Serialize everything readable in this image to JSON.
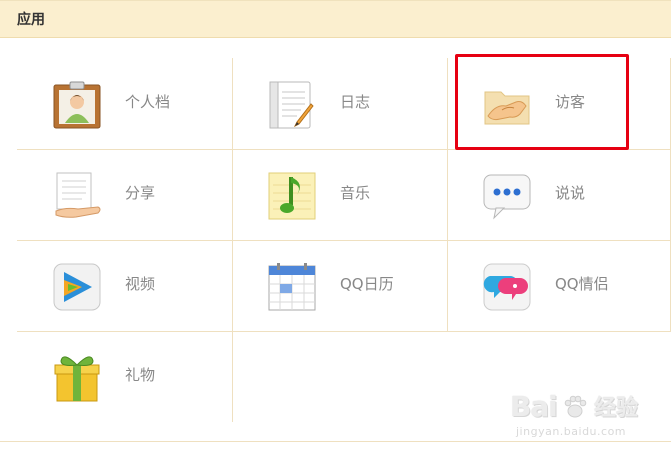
{
  "header": {
    "title": "应用"
  },
  "apps": [
    {
      "label": "个人档",
      "icon": "profile-clipboard-icon"
    },
    {
      "label": "日志",
      "icon": "diary-notebook-icon"
    },
    {
      "label": "访客",
      "icon": "visitor-handshake-icon"
    },
    {
      "label": "分享",
      "icon": "share-document-hand-icon"
    },
    {
      "label": "音乐",
      "icon": "music-note-icon"
    },
    {
      "label": "说说",
      "icon": "chat-bubble-icon"
    },
    {
      "label": "视频",
      "icon": "video-play-icon"
    },
    {
      "label": "QQ日历",
      "icon": "calendar-icon"
    },
    {
      "label": "QQ情侣",
      "icon": "couple-chat-icon"
    },
    {
      "label": "礼物",
      "icon": "gift-box-icon"
    }
  ],
  "highlight": {
    "target": "访客",
    "color": "#e60012"
  },
  "watermark": {
    "brand": "Bai",
    "suffix": "经验",
    "url": "jingyan.baidu.com"
  },
  "colors": {
    "header_bg": "#fbefcf",
    "grid_line": "#efe0c0",
    "label_text": "#888888"
  }
}
